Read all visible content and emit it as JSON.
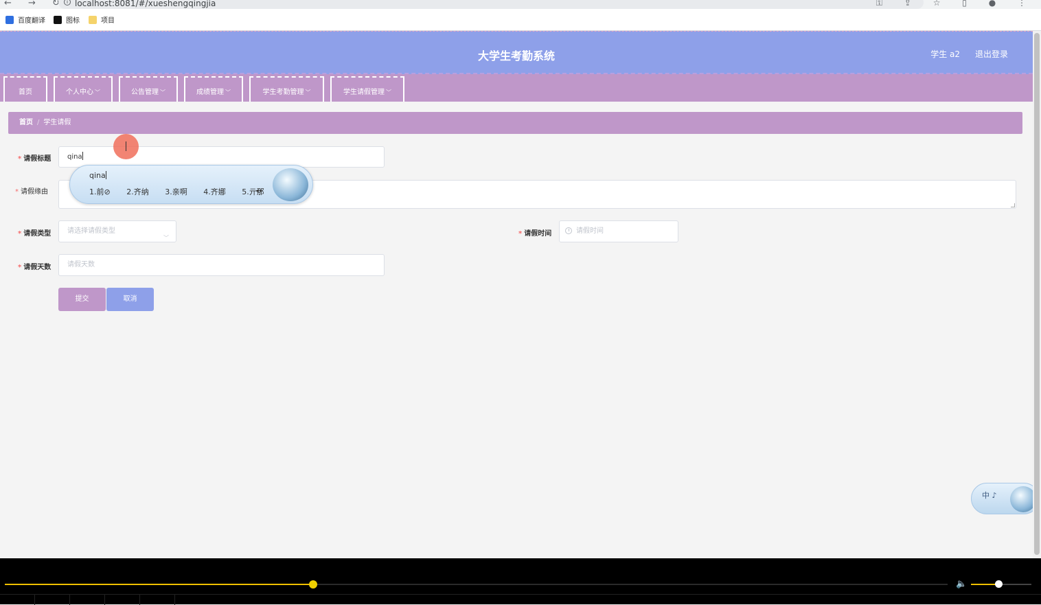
{
  "browser": {
    "url": "localhost:8081/#/xueshengqingjia",
    "nav_glyphs": "← → ↻",
    "right_glyphs": "⚿ ⇪ ☆ ▯ ● ⋮",
    "bookmarks": [
      {
        "label": "百度翻译",
        "icon_color": "#2f6fe0"
      },
      {
        "label": "图标",
        "icon_color": "#111111"
      },
      {
        "label": "项目",
        "icon_color": "#f5d36b"
      }
    ]
  },
  "header": {
    "title": "大学生考勤系统",
    "user": "学生 a2",
    "logout": "退出登录",
    "bg_color": "#8ea0e9"
  },
  "menu": {
    "items": [
      {
        "label": "首页",
        "dropdown": false
      },
      {
        "label": "个人中心",
        "dropdown": true
      },
      {
        "label": "公告管理",
        "dropdown": true
      },
      {
        "label": "成绩管理",
        "dropdown": true
      },
      {
        "label": "学生考勤管理",
        "dropdown": true
      },
      {
        "label": "学生请假管理",
        "dropdown": true
      }
    ],
    "bg_color": "#bf97c9"
  },
  "breadcrumb": {
    "home": "首页",
    "separator": "/",
    "current": "学生请假"
  },
  "form": {
    "title_label": "请假标题",
    "title_value": "qina",
    "reason_label": "请假缘由",
    "type_label": "请假类型",
    "type_placeholder": "请选择请假类型",
    "time_label": "请假时间",
    "time_placeholder": "请假时间",
    "days_label": "请假天数",
    "days_placeholder": "请假天数",
    "required_mark": "*",
    "submit": "提交",
    "cancel": "取消",
    "submit_color": "#bf97c9",
    "cancel_color": "#8ea0e9"
  },
  "ime": {
    "composition": "qina",
    "candidates": [
      "1.前⊘",
      "2.齐纳",
      "3.亲啊",
      "4.齐娜",
      "5.亓那"
    ],
    "page_arrows": "◂ ▸",
    "status_label": "中 ♪"
  },
  "player": {
    "progress": 0.327,
    "volume": 0.45,
    "volume_icon": "🔈",
    "accent": "#f0c000"
  }
}
